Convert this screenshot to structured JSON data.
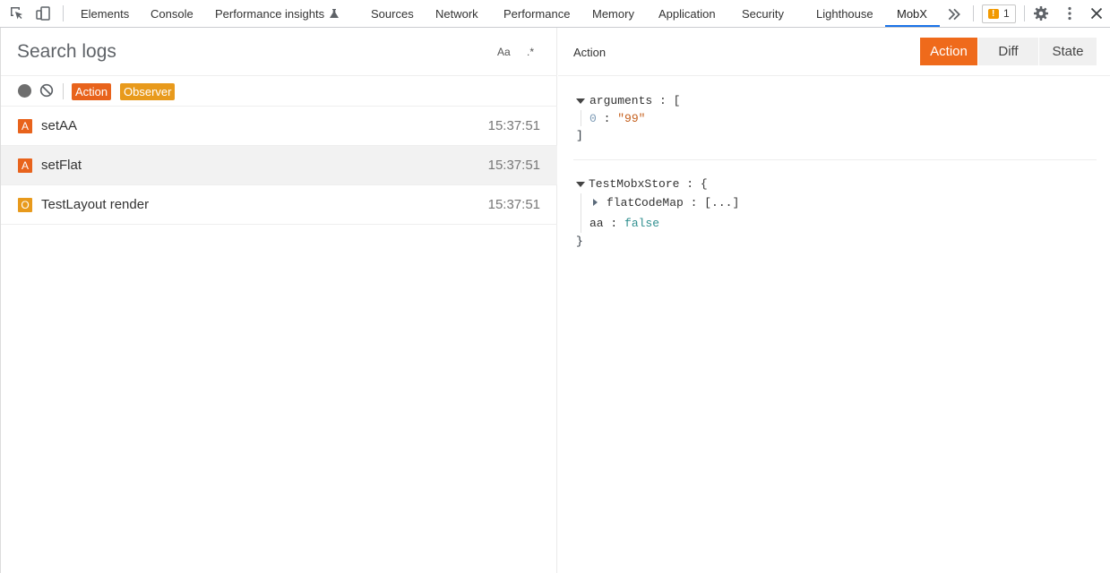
{
  "devtools_tabs": [
    "Elements",
    "Console",
    "Performance insights",
    "Sources",
    "Network",
    "Performance",
    "Memory",
    "Application",
    "Security",
    "Lighthouse",
    "MobX"
  ],
  "active_tab": "MobX",
  "issues_count": "1",
  "search": {
    "placeholder": "Search logs",
    "case_label": "Aa",
    "regex_label": ".*"
  },
  "filters": {
    "action_label": "Action",
    "observer_label": "Observer"
  },
  "logs": [
    {
      "badge": "A",
      "name": "setAA",
      "time": "15:37:51",
      "selected": false
    },
    {
      "badge": "A",
      "name": "setFlat",
      "time": "15:37:51",
      "selected": true
    },
    {
      "badge": "O",
      "name": "TestLayout render",
      "time": "15:37:51",
      "selected": false
    }
  ],
  "detail": {
    "title": "Action",
    "views": [
      "Action",
      "Diff",
      "State"
    ],
    "active_view": "Action",
    "arguments": {
      "key": "arguments",
      "open": "[",
      "close": "]",
      "items": [
        {
          "index": "0",
          "value": "\"99\""
        }
      ]
    },
    "store": {
      "key": "TestMobxStore",
      "open": "{",
      "close": "}",
      "fields": [
        {
          "key": "flatCodeMap",
          "value": "[...]",
          "collapsed": true
        },
        {
          "key": "aa",
          "value": "false",
          "collapsed": false
        }
      ]
    }
  },
  "colors": {
    "action": "#e8631c",
    "observer": "#e89a1c",
    "tab_accent": "#1a73e8"
  }
}
